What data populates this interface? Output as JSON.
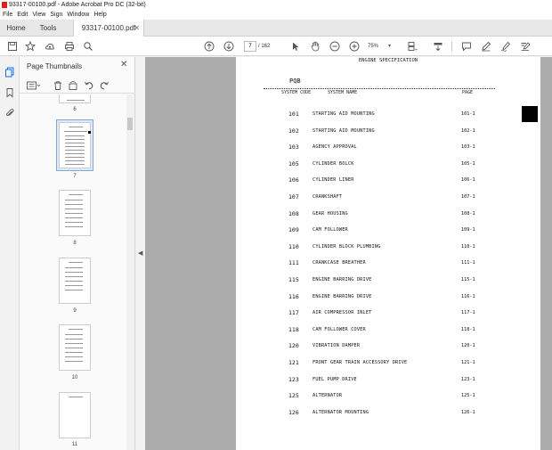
{
  "window": {
    "title": "93317-00100.pdf - Adobe Acrobat Pro DC (32-bit)"
  },
  "menu": [
    "File",
    "Edit",
    "View",
    "Sign",
    "Window",
    "Help"
  ],
  "tabs": {
    "home": "Home",
    "tools": "Tools",
    "document": "93317-00100.pdf"
  },
  "toolbar": {
    "current_page": "7",
    "page_total": "/ 162",
    "zoom": "75%"
  },
  "panel": {
    "title": "Page Thumbnails",
    "thumbnails": [
      {
        "label": "6"
      },
      {
        "label": "7"
      },
      {
        "label": "8"
      },
      {
        "label": "9"
      },
      {
        "label": "10"
      },
      {
        "label": "11"
      }
    ]
  },
  "document": {
    "header": "ENGINE SPECIFICATION",
    "model": "PQB",
    "col_code": "SYSTEM CODE",
    "col_name": "SYSTEM NAME",
    "col_page": "PAGE",
    "rows": [
      {
        "code": "101",
        "name": "STARTING AID MOUNTING",
        "page": "101-1"
      },
      {
        "code": "102",
        "name": "STARTING AID MOUNTING",
        "page": "102-1"
      },
      {
        "code": "103",
        "name": "AGENCY APPROVAL",
        "page": "103-1"
      },
      {
        "code": "105",
        "name": "CYLINDER BOLCK",
        "page": "105-1"
      },
      {
        "code": "106",
        "name": "CYLINDER LINER",
        "page": "106-1"
      },
      {
        "code": "107",
        "name": "CRANKSHAFT",
        "page": "107-1"
      },
      {
        "code": "108",
        "name": "GEAR HOUSING",
        "page": "108-1"
      },
      {
        "code": "109",
        "name": "CAM FOLLOWER",
        "page": "109-1"
      },
      {
        "code": "110",
        "name": "CYLINDER BLOCK PLUMBING",
        "page": "110-1"
      },
      {
        "code": "111",
        "name": "CRANKCASE BREATHER",
        "page": "111-1"
      },
      {
        "code": "115",
        "name": "ENGINE BARRING DRIVE",
        "page": "115-1"
      },
      {
        "code": "116",
        "name": "ENGINE BARRING DRIVE",
        "page": "116-1"
      },
      {
        "code": "117",
        "name": "AIR COMPRESSOR INLET",
        "page": "117-1"
      },
      {
        "code": "118",
        "name": "CAM FOLLOWER COVER",
        "page": "118-1"
      },
      {
        "code": "120",
        "name": "VIBRATION DAMPER",
        "page": "120-1"
      },
      {
        "code": "121",
        "name": "FRONT GEAR TRAIN ACCESSORY DRIVE",
        "page": "121-1"
      },
      {
        "code": "123",
        "name": "FUEL PUMP DRIVE",
        "page": "123-1"
      },
      {
        "code": "125",
        "name": "ALTERNATOR",
        "page": "125-1"
      },
      {
        "code": "126",
        "name": "ALTERNATOR MOUNTING",
        "page": "126-1"
      }
    ]
  }
}
